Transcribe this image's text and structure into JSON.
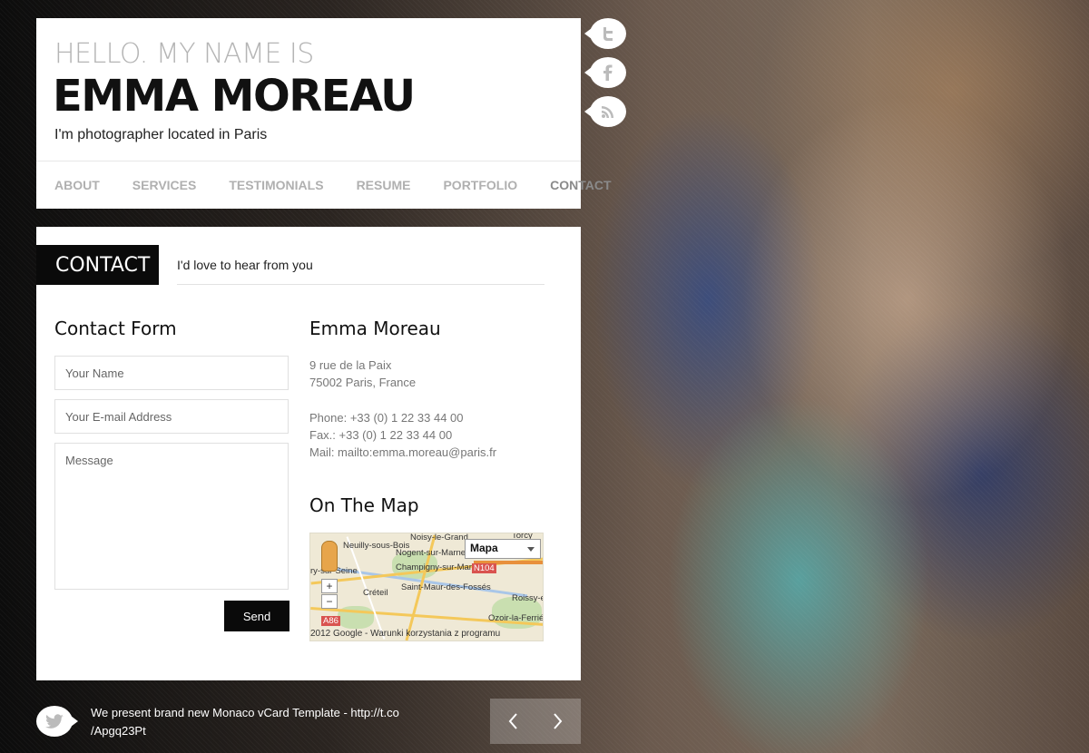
{
  "header": {
    "hello": "HELLO. MY NAME IS",
    "name": "EMMA MOREAU",
    "tagline": "I'm photographer located in Paris"
  },
  "nav": {
    "items": [
      "ABOUT",
      "SERVICES",
      "TESTIMONIALS",
      "RESUME",
      "PORTFOLIO",
      "CONTACT"
    ],
    "active": "CONTACT"
  },
  "social": {
    "icons": [
      "twitter-icon",
      "facebook-icon",
      "rss-icon"
    ]
  },
  "contact": {
    "label": "CONTACT",
    "subtitle": "I'd love to hear from you",
    "form": {
      "title": "Contact Form",
      "name_placeholder": "Your Name",
      "email_placeholder": "Your E-mail Address",
      "message_placeholder": "Message",
      "send_label": "Send"
    },
    "info": {
      "name": "Emma Moreau",
      "address_line1": "9 rue de la Paix",
      "address_line2": "75002 Paris, France",
      "phone": "Phone: +33 (0) 1 22 33 44 00",
      "fax": "Fax.: +33 (0) 1 22 33 44 00",
      "mail": "Mail: mailto:emma.moreau@paris.fr"
    },
    "map": {
      "title": "On The Map",
      "type_select": "Mapa",
      "zoom_in": "+",
      "zoom_out": "−",
      "terms": "2012 Google - Warunki korzystania z programu",
      "places": [
        "Noisy-le-Grand",
        "Neuilly-sous-Bois",
        "Nogent-sur-Marne",
        "Champigny-sur-Marne",
        "Créteil",
        "Saint-Maur-des-Fossés",
        "Roissy-e",
        "Ozoir-la-Ferrié",
        "ry-sur-Seine",
        "N104",
        "A86",
        "Torcy"
      ]
    }
  },
  "footer": {
    "tweet_line1": "We present brand new Monaco vCard Template - http://t.co",
    "tweet_line2": "/Apgq23Pt",
    "prev_label": "‹",
    "next_label": "›"
  },
  "colors": {
    "accent": "#0a0a0a",
    "nav_text": "#b0b0b0"
  }
}
